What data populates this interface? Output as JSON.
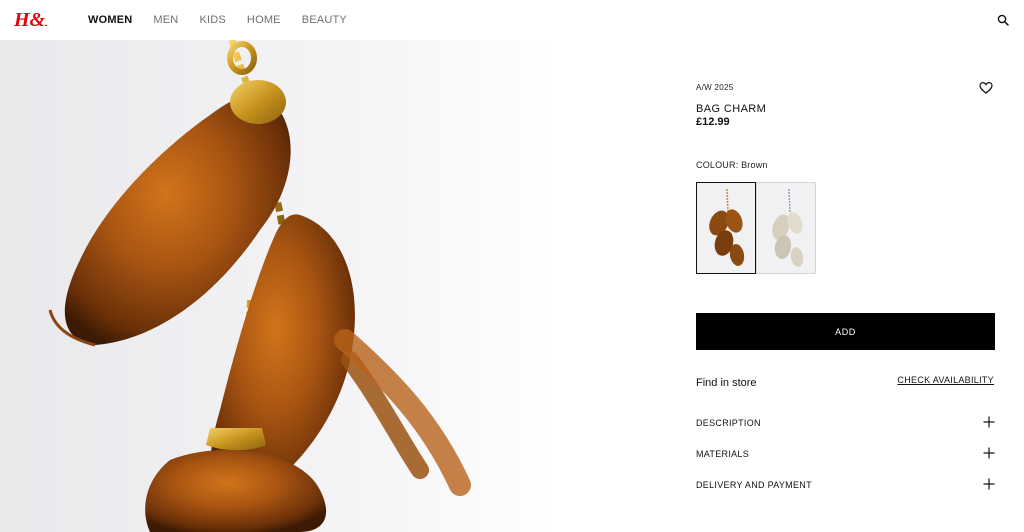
{
  "header": {
    "logo_text": "H&M",
    "nav": [
      {
        "label": "WOMEN",
        "active": true
      },
      {
        "label": "MEN",
        "active": false
      },
      {
        "label": "KIDS",
        "active": false
      },
      {
        "label": "HOME",
        "active": false
      },
      {
        "label": "BEAUTY",
        "active": false
      }
    ],
    "search_icon": "search-icon",
    "brand_color": "#e50010"
  },
  "product": {
    "season": "A/W 2025",
    "title": "BAG CHARM",
    "price": "£12.99",
    "colour_label": "COLOUR: Brown",
    "swatches": [
      {
        "name": "Brown",
        "selected": true,
        "color": "#8a4a12"
      },
      {
        "name": "Beige",
        "selected": false,
        "color": "#d9d2c3"
      }
    ],
    "add_label": "ADD",
    "find_in_store": "Find in store",
    "check_availability": "CHECK AVAILABILITY",
    "accordions": [
      "DESCRIPTION",
      "MATERIALS",
      "DELIVERY AND PAYMENT"
    ],
    "wishlist_icon": "heart-icon"
  }
}
